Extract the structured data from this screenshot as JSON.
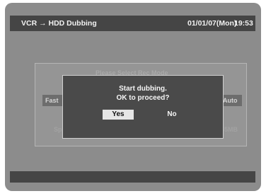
{
  "header": {
    "title": "VCR → HDD Dubbing",
    "date": "01/01/07(Mon)",
    "time": "19:53"
  },
  "background_panel": {
    "heading": "Please Select Rec Mode",
    "left_option": "Fast",
    "right_option": "Auto",
    "bottom_left": "Sp",
    "bottom_right": "45MB"
  },
  "dialog": {
    "line1": "Start dubbing.",
    "line2": "OK to proceed?",
    "yes_label": "Yes",
    "no_label": "No",
    "selected": "Yes"
  },
  "colors": {
    "screen_bg": "#8c8c8c",
    "bar_bg": "#454545",
    "dialog_bg": "#4a4a4a",
    "selected_button_bg": "#e6e6e6"
  }
}
